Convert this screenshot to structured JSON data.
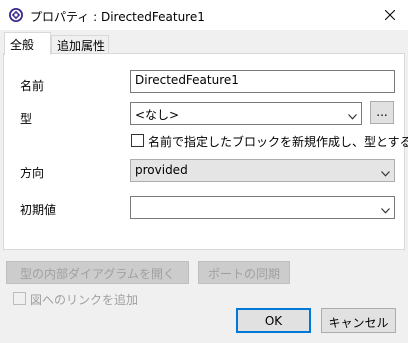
{
  "window": {
    "title": "プロパティ : DirectedFeature1",
    "icon": "feature-icon",
    "close_icon": "close-icon"
  },
  "tabs": [
    {
      "label": "全般",
      "active": true
    },
    {
      "label": "追加属性",
      "active": false
    }
  ],
  "form": {
    "name_label": "名前",
    "name_value": "DirectedFeature1",
    "type_label": "型",
    "type_value": "<なし>",
    "type_browse_label": "...",
    "create_block_label": "名前で指定したブロックを新規作成し、型とする",
    "create_block_checked": false,
    "direction_label": "方向",
    "direction_value": "provided",
    "initial_label": "初期値",
    "initial_value": ""
  },
  "footer": {
    "open_diagram_label": "型の内部ダイアグラムを開く",
    "sync_ports_label": "ポートの同期",
    "add_link_label": "図へのリンクを追加",
    "add_link_checked": false,
    "ok_label": "OK",
    "cancel_label": "キャンセル"
  },
  "colors": {
    "accent": "#0078d7",
    "icon_purple": "#3b2d8f"
  }
}
